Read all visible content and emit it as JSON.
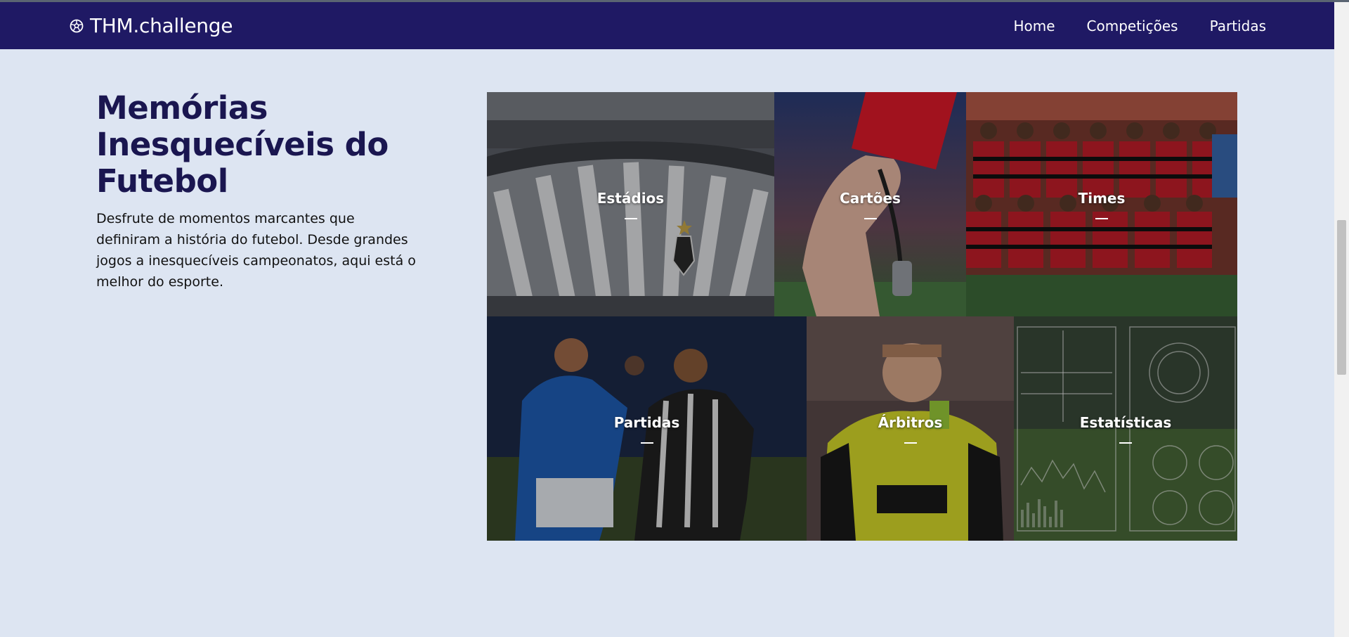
{
  "brand": {
    "icon": "soccer-ball-icon",
    "name": "THM.challenge"
  },
  "nav": {
    "links": [
      "Home",
      "Competições",
      "Partidas"
    ]
  },
  "hero": {
    "title": "Memórias Inesquecíveis do Futebol",
    "description": "Desfrute de momentos marcantes que definiram a história do futebol. Desde grandes jogos a inesquecíveis campeonatos, aqui está o melhor do esporte."
  },
  "gallery": {
    "tiles": [
      {
        "label": "Estádios"
      },
      {
        "label": "Cartões"
      },
      {
        "label": "Times"
      },
      {
        "label": "Partidas"
      },
      {
        "label": "Árbitros"
      },
      {
        "label": "Estatísticas"
      }
    ]
  },
  "colors": {
    "navbar": "#1f1964",
    "background": "#dde5f2",
    "title": "#1a1650"
  }
}
